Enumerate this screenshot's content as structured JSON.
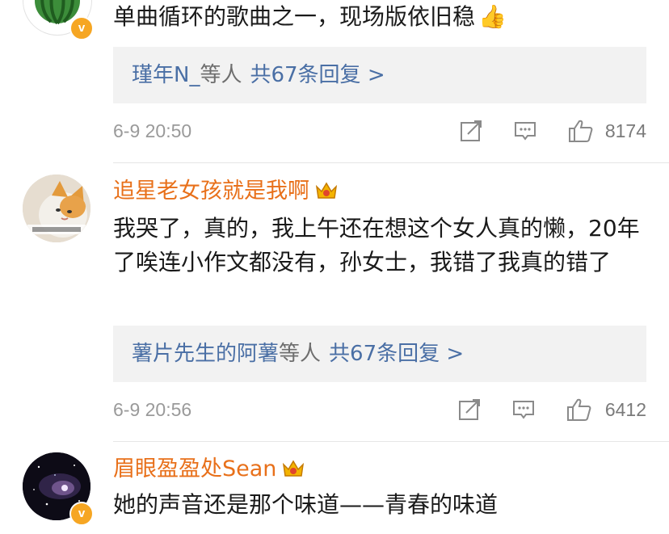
{
  "comments": [
    {
      "content": "单曲循环的歌曲之一，现场版依旧稳",
      "thumb_emoji": "👍",
      "avatar_icon": "watermelon-avatar",
      "reply": {
        "users": "瑾年N_",
        "etc": "等人",
        "count": "共67条回复 >"
      },
      "time": "6-9 20:50",
      "likes": "8174"
    },
    {
      "username": "追星老女孩就是我啊",
      "content": "我哭了，真的，我上午还在想这个女人真的懒，20年了唉连小作文都没有，孙女士，我错了我真的错了",
      "avatar_icon": "cat-avatar",
      "reply": {
        "users": "薯片先生的阿薯",
        "etc": "等人",
        "count": "共67条回复 >"
      },
      "time": "6-9 20:56",
      "likes": "6412"
    },
    {
      "username": "眉眼盈盈处Sean",
      "content": "她的声音还是那个味道——青春的味道",
      "avatar_icon": "galaxy-avatar"
    }
  ],
  "colors": {
    "username": "#e8701a",
    "reply_link": "#4a6fa5",
    "reply_bg": "#f2f2f2",
    "meta": "#9a9a9a",
    "badge": "#f6a623"
  }
}
